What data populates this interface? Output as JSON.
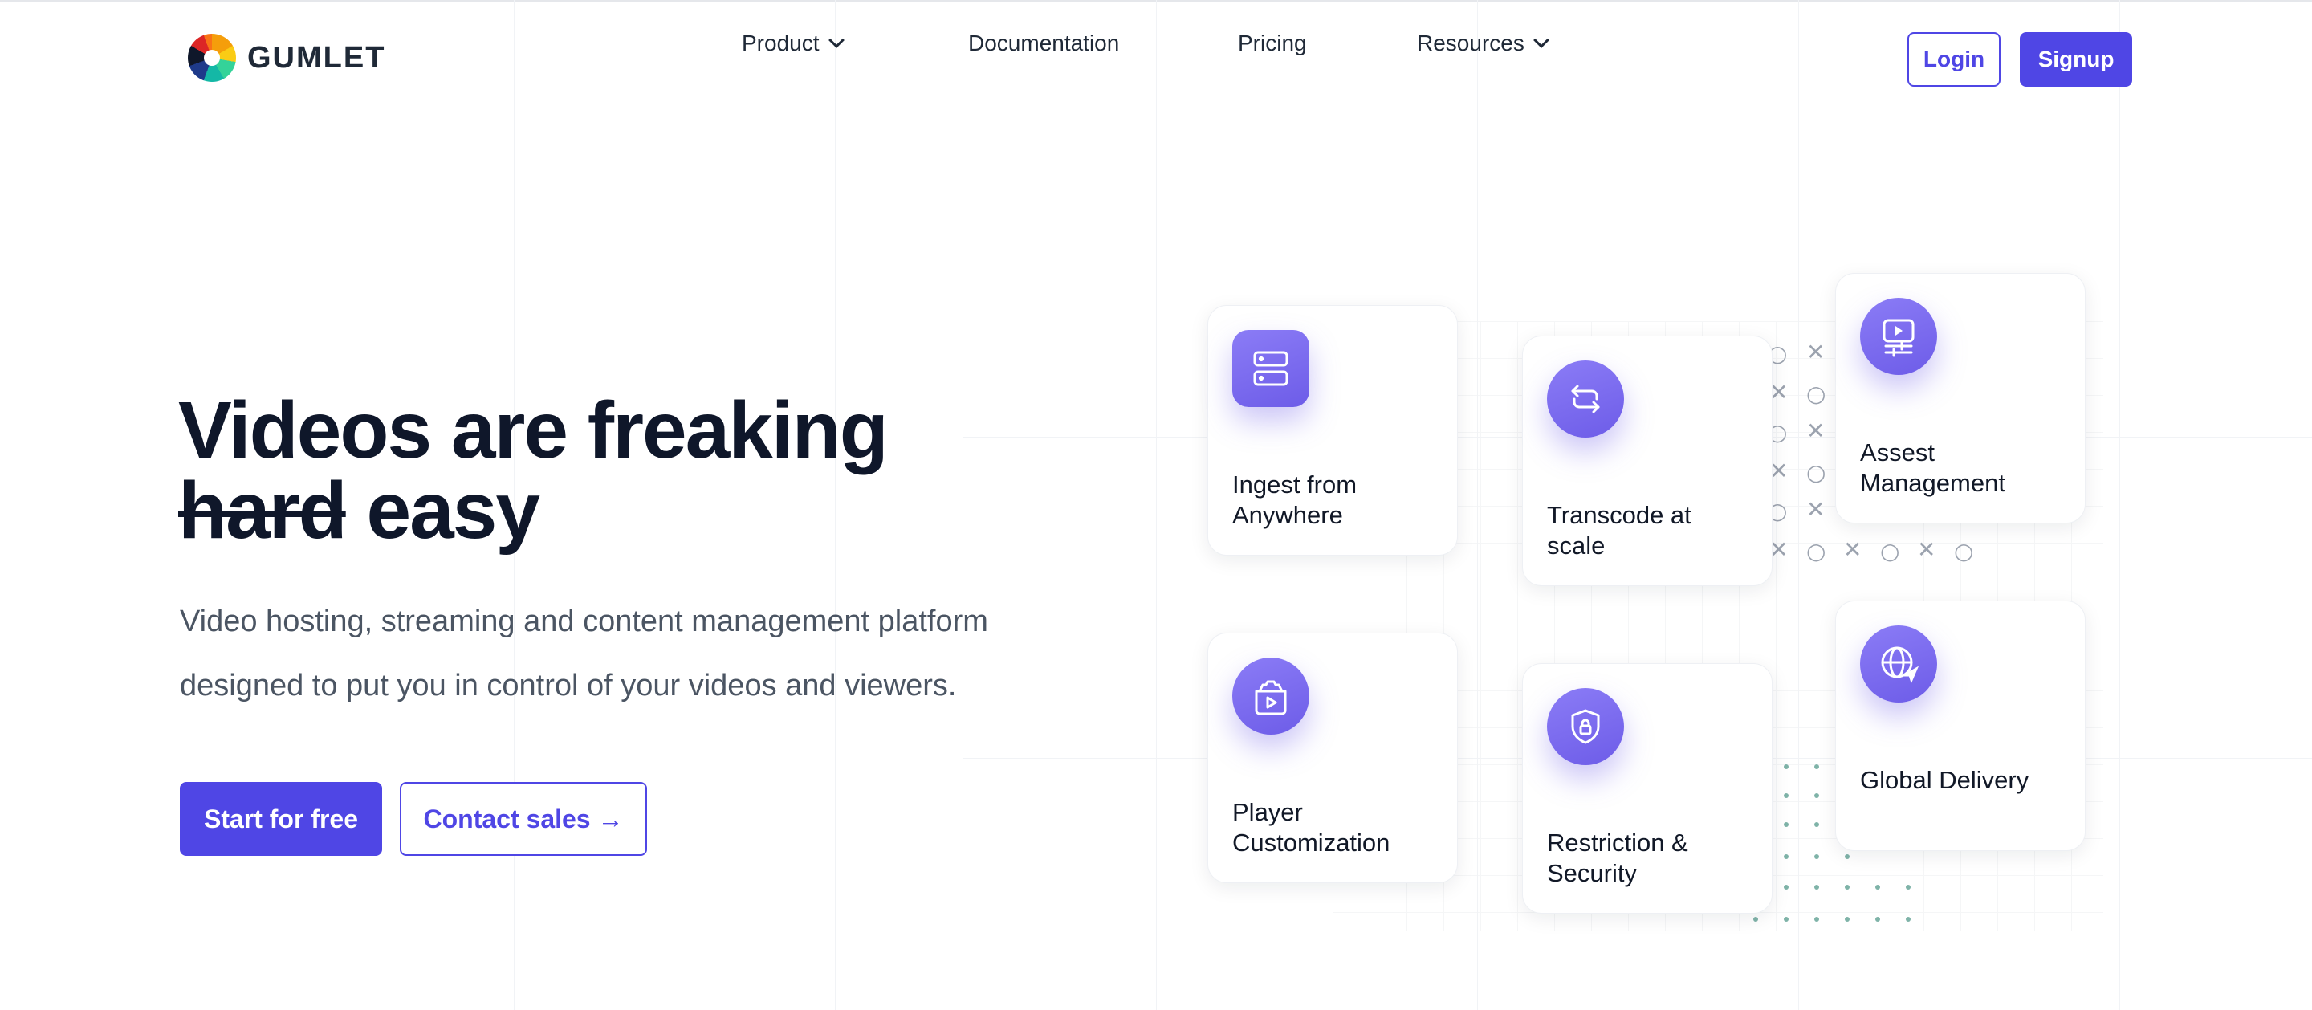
{
  "header": {
    "logo_text": "GUMLET",
    "nav": [
      {
        "label": "Product",
        "has_dropdown": true
      },
      {
        "label": "Documentation",
        "has_dropdown": false
      },
      {
        "label": "Pricing",
        "has_dropdown": false
      },
      {
        "label": "Resources",
        "has_dropdown": true
      }
    ],
    "login_label": "Login",
    "signup_label": "Signup"
  },
  "hero": {
    "title_line1": "Videos are freaking",
    "title_strike": "hard",
    "title_end": "easy",
    "subtitle": "Video hosting, streaming and content management platform designed to put you in control of your videos and viewers.",
    "cta_primary": "Start for free",
    "cta_secondary": "Contact sales →"
  },
  "features": [
    {
      "label": "Ingest from Anywhere",
      "icon": "server-icon"
    },
    {
      "label": "Transcode at scale",
      "icon": "repeat-arrows-icon"
    },
    {
      "label": "Assest Management",
      "icon": "video-settings-icon"
    },
    {
      "label": "Player Customization",
      "icon": "player-gear-icon"
    },
    {
      "label": "Restriction & Security",
      "icon": "shield-lock-icon"
    },
    {
      "label": "Global Delivery",
      "icon": "globe-send-icon"
    }
  ],
  "colors": {
    "brand": "#4f46e5",
    "icon_gradient_start": "#8b7cf6",
    "icon_gradient_end": "#6d5ce8"
  }
}
